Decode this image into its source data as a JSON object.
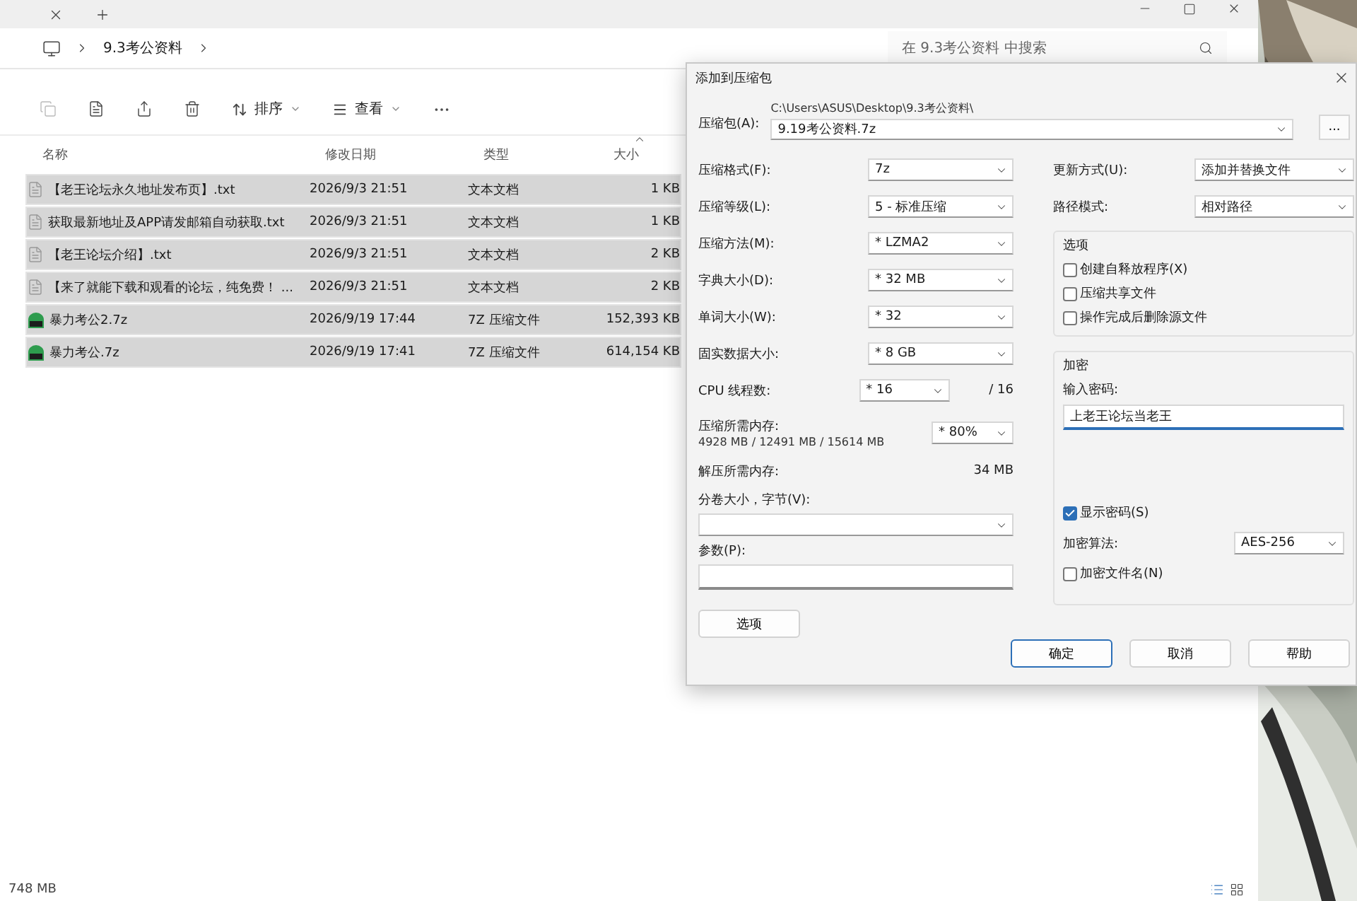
{
  "explorer": {
    "breadcrumb": [
      "9.3考公资料"
    ],
    "search": {
      "placeholder": "在 9.3考公资料 中搜索"
    },
    "toolbar": {
      "sort": "排序",
      "view": "查看"
    },
    "columns": [
      "名称",
      "修改日期",
      "类型",
      "大小"
    ],
    "files": [
      {
        "name": "【老王论坛永久地址发布页】.txt",
        "modified": "2026/9/3 21:51",
        "type": "文本文档",
        "size": "1 KB",
        "kind": "text",
        "selected": true
      },
      {
        "name": "获取最新地址及APP请发邮箱自动获取.txt",
        "modified": "2026/9/3 21:51",
        "type": "文本文档",
        "size": "1 KB",
        "kind": "text",
        "selected": true
      },
      {
        "name": "【老王论坛介绍】.txt",
        "modified": "2026/9/3 21:51",
        "type": "文本文档",
        "size": "2 KB",
        "kind": "text",
        "selected": true
      },
      {
        "name": "【来了就能下载和观看的论坛，纯免费！ ...",
        "modified": "2026/9/3 21:51",
        "type": "文本文档",
        "size": "2 KB",
        "kind": "text",
        "selected": true
      },
      {
        "name": "暴力考公2.7z",
        "modified": "2026/9/19 17:44",
        "type": "7Z 压缩文件",
        "size": "152,393 KB",
        "kind": "archive",
        "selected": true
      },
      {
        "name": "暴力考公.7z",
        "modified": "2026/9/19 17:41",
        "type": "7Z 压缩文件",
        "size": "614,154 KB",
        "kind": "archive",
        "selected": true
      }
    ],
    "status": "748 MB"
  },
  "dialog": {
    "title": "添加到压缩包",
    "archive_label": "压缩包(A):",
    "archive_dir": "C:\\Users\\ASUS\\Desktop\\9.3考公资料\\",
    "archive_name": "9.19考公资料.7z",
    "browse": "...",
    "left_rows": [
      {
        "label": "压缩格式(F):",
        "kind": "select",
        "value": "7z"
      },
      {
        "label": "压缩等级(L):",
        "kind": "select",
        "value": "5 - 标准压缩"
      },
      {
        "label": "压缩方法(M):",
        "kind": "select",
        "value": "* LZMA2"
      },
      {
        "label": "字典大小(D):",
        "kind": "select",
        "value": "* 32 MB"
      },
      {
        "label": "单词大小(W):",
        "kind": "select",
        "value": "* 32"
      },
      {
        "label": "固实数据大小:",
        "kind": "select",
        "value": "* 8 GB"
      },
      {
        "label": "CPU 线程数:",
        "kind": "select_short",
        "value": "* 16",
        "note": "/ 16"
      },
      {
        "label": "压缩所需内存:",
        "kind": "memory",
        "detail": "4928 MB / 12491 MB / 15614 MB",
        "value": "* 80%"
      },
      {
        "label": "解压所需内存:",
        "kind": "readout",
        "value": "34 MB"
      },
      {
        "label": "分卷大小，字节(V):",
        "kind": "select_wide"
      },
      {
        "label": "参数(P):",
        "kind": "input_wide"
      }
    ],
    "options_button": "选项",
    "right_rows": [
      {
        "label": "更新方式(U):",
        "value": "添加并替换文件"
      },
      {
        "label": "路径模式:",
        "value": "相对路径"
      }
    ],
    "options": {
      "title": "选项",
      "items": [
        {
          "label": "创建自释放程序(X)",
          "checked": false
        },
        {
          "label": "压缩共享文件",
          "checked": false
        },
        {
          "label": "操作完成后删除源文件",
          "checked": false
        }
      ]
    },
    "encryption": {
      "title": "加密",
      "password_label": "输入密码:",
      "password": "上老王论坛当老王",
      "show_password": {
        "label": "显示密码(S)",
        "checked": true
      },
      "method_label": "加密算法:",
      "method": "AES-256",
      "encrypt_names": {
        "label": "加密文件名(N)",
        "checked": false
      }
    },
    "buttons": [
      {
        "label": "确定",
        "default": true
      },
      {
        "label": "取消",
        "default": false
      },
      {
        "label": "帮助",
        "default": false
      }
    ]
  }
}
